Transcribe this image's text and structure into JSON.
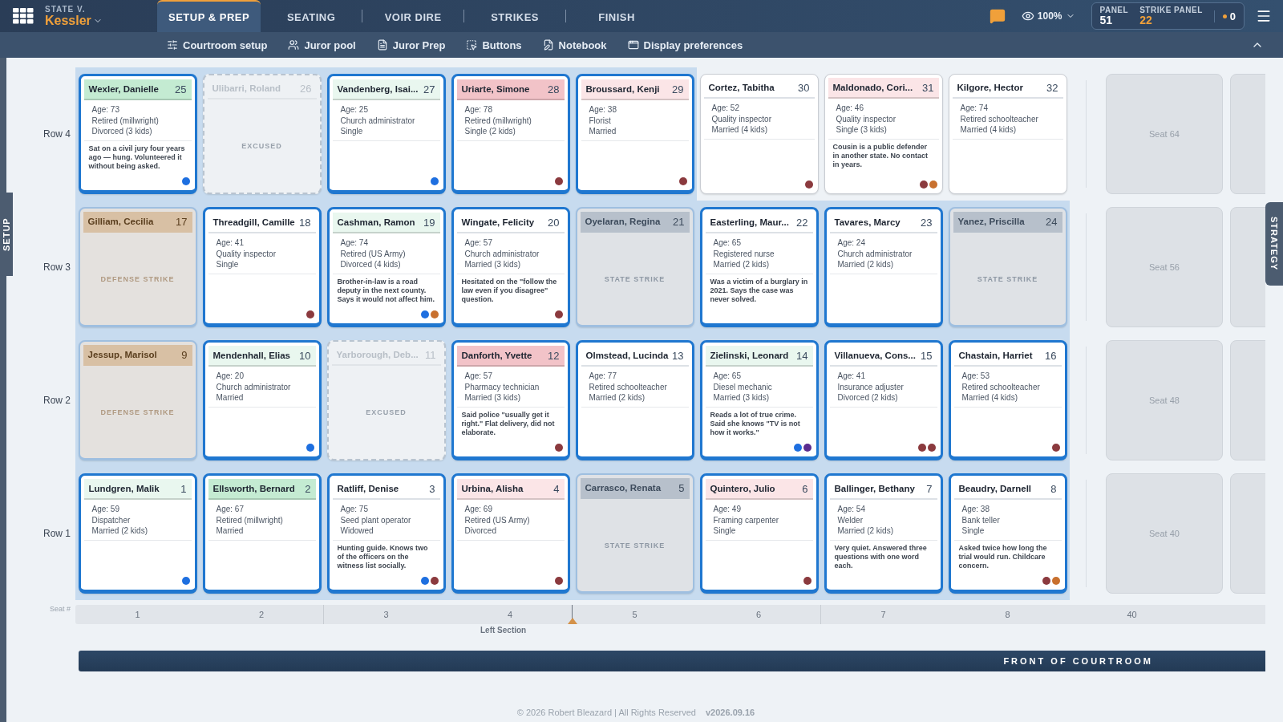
{
  "case": {
    "overline": "STATE V.",
    "name": "Kessler"
  },
  "tabs": [
    {
      "label": "SETUP & PREP",
      "selected": true
    },
    {
      "label": "SEATING",
      "selected": false
    },
    {
      "label": "VOIR DIRE",
      "selected": false
    },
    {
      "label": "STRIKES",
      "selected": false
    },
    {
      "label": "FINISH",
      "selected": false
    }
  ],
  "zoom": "100%",
  "counts": {
    "panel_label": "PANEL",
    "panel": "51",
    "strike_label": "STRIKE PANEL",
    "strike": "22",
    "alerts": "0"
  },
  "subnav": [
    {
      "label": "Courtroom setup"
    },
    {
      "label": "Juror pool"
    },
    {
      "label": "Juror Prep"
    },
    {
      "label": "Buttons"
    },
    {
      "label": "Notebook"
    },
    {
      "label": "Display preferences"
    }
  ],
  "side_tabs": {
    "left": "SETUP",
    "right": "STRATEGY"
  },
  "rows": [
    {
      "label": "Row 4",
      "empty_seats": [
        "Seat 64"
      ],
      "seats": [
        {
          "kind": "juror",
          "seat": "25",
          "name": "Wexler, Danielle",
          "color": "#c4ebd2",
          "in_panel": true,
          "details": [
            "Age: 73",
            "Retired (millwright)",
            "Divorced (3 kids)"
          ],
          "note": "Sat on a civil jury four years ago — hung. Volunteered it without being asked.",
          "flags": [
            {
              "color": "#1e6fe0"
            }
          ]
        },
        {
          "kind": "excused",
          "seat": "26",
          "name": "Ulibarri, Roland",
          "label": "EXCUSED",
          "in_panel": true
        },
        {
          "kind": "juror",
          "seat": "27",
          "name": "Vandenberg, Isai...",
          "color": "#e9f7ef",
          "in_panel": true,
          "details": [
            "Age: 25",
            "Church administrator",
            "Single"
          ],
          "flags": [
            {
              "color": "#1e6fe0"
            }
          ]
        },
        {
          "kind": "juror",
          "seat": "28",
          "name": "Uriarte, Simone",
          "color": "#f2c3c8",
          "in_panel": true,
          "details": [
            "Age: 78",
            "Retired (millwright)",
            "Single (2 kids)"
          ],
          "flags": [
            {
              "color": "#8b3a3e"
            }
          ]
        },
        {
          "kind": "juror",
          "seat": "29",
          "name": "Broussard, Kenji",
          "color": "#fbe5e7",
          "in_panel": true,
          "details": [
            "Age: 38",
            "Florist",
            "Married"
          ],
          "flags": [
            {
              "color": "#8b3a3e"
            }
          ]
        },
        {
          "kind": "juror",
          "seat": "30",
          "name": "Cortez, Tabitha",
          "in_panel": false,
          "details": [
            "Age: 52",
            "Quality inspector",
            "Married (4 kids)"
          ],
          "flags": [
            {
              "color": "#8b3a3e"
            }
          ]
        },
        {
          "kind": "juror",
          "seat": "31",
          "name": "Maldonado, Cori...",
          "color": "#fbe5e7",
          "in_panel": false,
          "details": [
            "Age: 46",
            "Quality inspector",
            "Single (3 kids)"
          ],
          "note": "Cousin is a public defender in another state. No contact in years.",
          "flags": [
            {
              "color": "#8b3a3e"
            },
            {
              "color": "#c8702e"
            }
          ]
        },
        {
          "kind": "juror",
          "seat": "32",
          "name": "Kilgore, Hector",
          "in_panel": false,
          "details": [
            "Age: 74",
            "Retired schoolteacher",
            "Married (4 kids)"
          ]
        }
      ]
    },
    {
      "label": "Row 3",
      "empty_seats": [
        "Seat 56"
      ],
      "seats": [
        {
          "kind": "defense_strike",
          "seat": "17",
          "name": "Gilliam, Cecilia",
          "label": "DEFENSE STRIKE",
          "in_panel": true
        },
        {
          "kind": "juror",
          "seat": "18",
          "name": "Threadgill, Camille",
          "in_panel": true,
          "details": [
            "Age: 41",
            "Quality inspector",
            "Single"
          ],
          "flags": [
            {
              "color": "#8b3a3e"
            }
          ]
        },
        {
          "kind": "juror",
          "seat": "19",
          "name": "Cashman, Ramon",
          "color": "#e9f7ef",
          "in_panel": true,
          "details": [
            "Age: 74",
            "Retired (US Army)",
            "Divorced (4 kids)"
          ],
          "note": "Brother-in-law is a road deputy in the next county. Says it would not affect him.",
          "flags": [
            {
              "color": "#1e6fe0"
            },
            {
              "color": "#c8702e"
            }
          ]
        },
        {
          "kind": "juror",
          "seat": "20",
          "name": "Wingate, Felicity",
          "in_panel": true,
          "details": [
            "Age: 57",
            "Church administrator",
            "Married (3 kids)"
          ],
          "note": "Hesitated on the \"follow the law even if you disagree\" question.",
          "flags": [
            {
              "color": "#8b3a3e"
            }
          ]
        },
        {
          "kind": "state_strike",
          "seat": "21",
          "name": "Oyelaran, Regina",
          "label": "STATE STRIKE",
          "in_panel": true
        },
        {
          "kind": "juror",
          "seat": "22",
          "name": "Easterling, Maur...",
          "in_panel": true,
          "details": [
            "Age: 65",
            "Registered nurse",
            "Married (2 kids)"
          ],
          "note": "Was a victim of a burglary in 2021. Says the case was never solved."
        },
        {
          "kind": "juror",
          "seat": "23",
          "name": "Tavares, Marcy",
          "in_panel": true,
          "details": [
            "Age: 24",
            "Church administrator",
            "Married (2 kids)"
          ]
        },
        {
          "kind": "state_strike",
          "seat": "24",
          "name": "Yanez, Priscilla",
          "label": "STATE STRIKE",
          "in_panel": true
        }
      ]
    },
    {
      "label": "Row 2",
      "empty_seats": [
        "Seat 48"
      ],
      "seats": [
        {
          "kind": "defense_strike",
          "seat": "9",
          "name": "Jessup, Marisol",
          "label": "DEFENSE STRIKE",
          "in_panel": true
        },
        {
          "kind": "juror",
          "seat": "10",
          "name": "Mendenhall, Elias",
          "color": "#e9f7ef",
          "in_panel": true,
          "details": [
            "Age: 20",
            "Church administrator",
            "Married"
          ],
          "flags": [
            {
              "color": "#1e6fe0"
            }
          ]
        },
        {
          "kind": "excused",
          "seat": "11",
          "name": "Yarborough, Deb...",
          "label": "EXCUSED",
          "in_panel": true
        },
        {
          "kind": "juror",
          "seat": "12",
          "name": "Danforth, Yvette",
          "color": "#f2c3c8",
          "in_panel": true,
          "details": [
            "Age: 57",
            "Pharmacy technician",
            "Married (3 kids)"
          ],
          "note": "Said police \"usually get it right.\" Flat delivery, did not elaborate.",
          "flags": [
            {
              "color": "#8b3a3e"
            }
          ]
        },
        {
          "kind": "juror",
          "seat": "13",
          "name": "Olmstead, Lucinda",
          "in_panel": true,
          "details": [
            "Age: 77",
            "Retired schoolteacher",
            "Married (2 kids)"
          ]
        },
        {
          "kind": "juror",
          "seat": "14",
          "name": "Zielinski, Leonard",
          "color": "#e9f7ef",
          "in_panel": true,
          "details": [
            "Age: 65",
            "Diesel mechanic",
            "Married (3 kids)"
          ],
          "note": "Reads a lot of true crime. Said she knows \"TV is not how it works.\"",
          "flags": [
            {
              "color": "#1e6fe0"
            },
            {
              "color": "#5b2c8f"
            }
          ]
        },
        {
          "kind": "juror",
          "seat": "15",
          "name": "Villanueva, Cons...",
          "in_panel": true,
          "details": [
            "Age: 41",
            "Insurance adjuster",
            "Divorced (2 kids)"
          ],
          "flags": [
            {
              "color": "#8b3a3e"
            },
            {
              "color": "#8b3a3e"
            }
          ]
        },
        {
          "kind": "juror",
          "seat": "16",
          "name": "Chastain, Harriet",
          "in_panel": true,
          "details": [
            "Age: 53",
            "Retired schoolteacher",
            "Married (4 kids)"
          ],
          "flags": [
            {
              "color": "#8b3a3e"
            }
          ]
        }
      ]
    },
    {
      "label": "Row 1",
      "empty_seats": [
        "Seat 40"
      ],
      "seats": [
        {
          "kind": "juror",
          "seat": "1",
          "name": "Lundgren, Malik",
          "color": "#e9f7ef",
          "in_panel": true,
          "details": [
            "Age: 59",
            "Dispatcher",
            "Married (2 kids)"
          ],
          "flags": [
            {
              "color": "#1e6fe0"
            }
          ]
        },
        {
          "kind": "juror",
          "seat": "2",
          "name": "Ellsworth, Bernard",
          "color": "#c4ebd2",
          "in_panel": true,
          "details": [
            "Age: 67",
            "Retired (millwright)",
            "Married"
          ]
        },
        {
          "kind": "juror",
          "seat": "3",
          "name": "Ratliff, Denise",
          "in_panel": true,
          "details": [
            "Age: 75",
            "Seed plant operator",
            "Widowed"
          ],
          "note": "Hunting guide. Knows two of the officers on the witness list socially.",
          "flags": [
            {
              "color": "#1e6fe0"
            },
            {
              "color": "#8b3a3e"
            }
          ]
        },
        {
          "kind": "juror",
          "seat": "4",
          "name": "Urbina, Alisha",
          "color": "#fbe5e7",
          "in_panel": true,
          "details": [
            "Age: 69",
            "Retired (US Army)",
            "Divorced"
          ],
          "flags": [
            {
              "color": "#8b3a3e"
            }
          ]
        },
        {
          "kind": "state_strike",
          "seat": "5",
          "name": "Carrasco, Renata",
          "label": "STATE STRIKE",
          "in_panel": true
        },
        {
          "kind": "juror",
          "seat": "6",
          "name": "Quintero, Julio",
          "color": "#fbe5e7",
          "in_panel": true,
          "details": [
            "Age: 49",
            "Framing carpenter",
            "Single"
          ],
          "flags": [
            {
              "color": "#8b3a3e"
            }
          ]
        },
        {
          "kind": "juror",
          "seat": "7",
          "name": "Ballinger, Bethany",
          "in_panel": true,
          "details": [
            "Age: 54",
            "Welder",
            "Married (2 kids)"
          ],
          "note": "Very quiet. Answered three questions with one word each."
        },
        {
          "kind": "juror",
          "seat": "8",
          "name": "Beaudry, Darnell",
          "in_panel": true,
          "details": [
            "Age: 38",
            "Bank teller",
            "Single"
          ],
          "note": "Asked twice how long the trial would run. Childcare concern.",
          "flags": [
            {
              "color": "#8b3a3e"
            },
            {
              "color": "#c8702e"
            }
          ]
        }
      ]
    }
  ],
  "seat_axis": {
    "label": "Seat #",
    "numbers": [
      "1",
      "2",
      "3",
      "4",
      "5",
      "6",
      "7",
      "8"
    ],
    "extra": "40",
    "section": "Left Section"
  },
  "front_banner": "FRONT OF COURTROOM",
  "footer": {
    "copyright": "© 2026 Robert Bleazard | All Rights Reserved",
    "version": "v2026.09.16"
  }
}
